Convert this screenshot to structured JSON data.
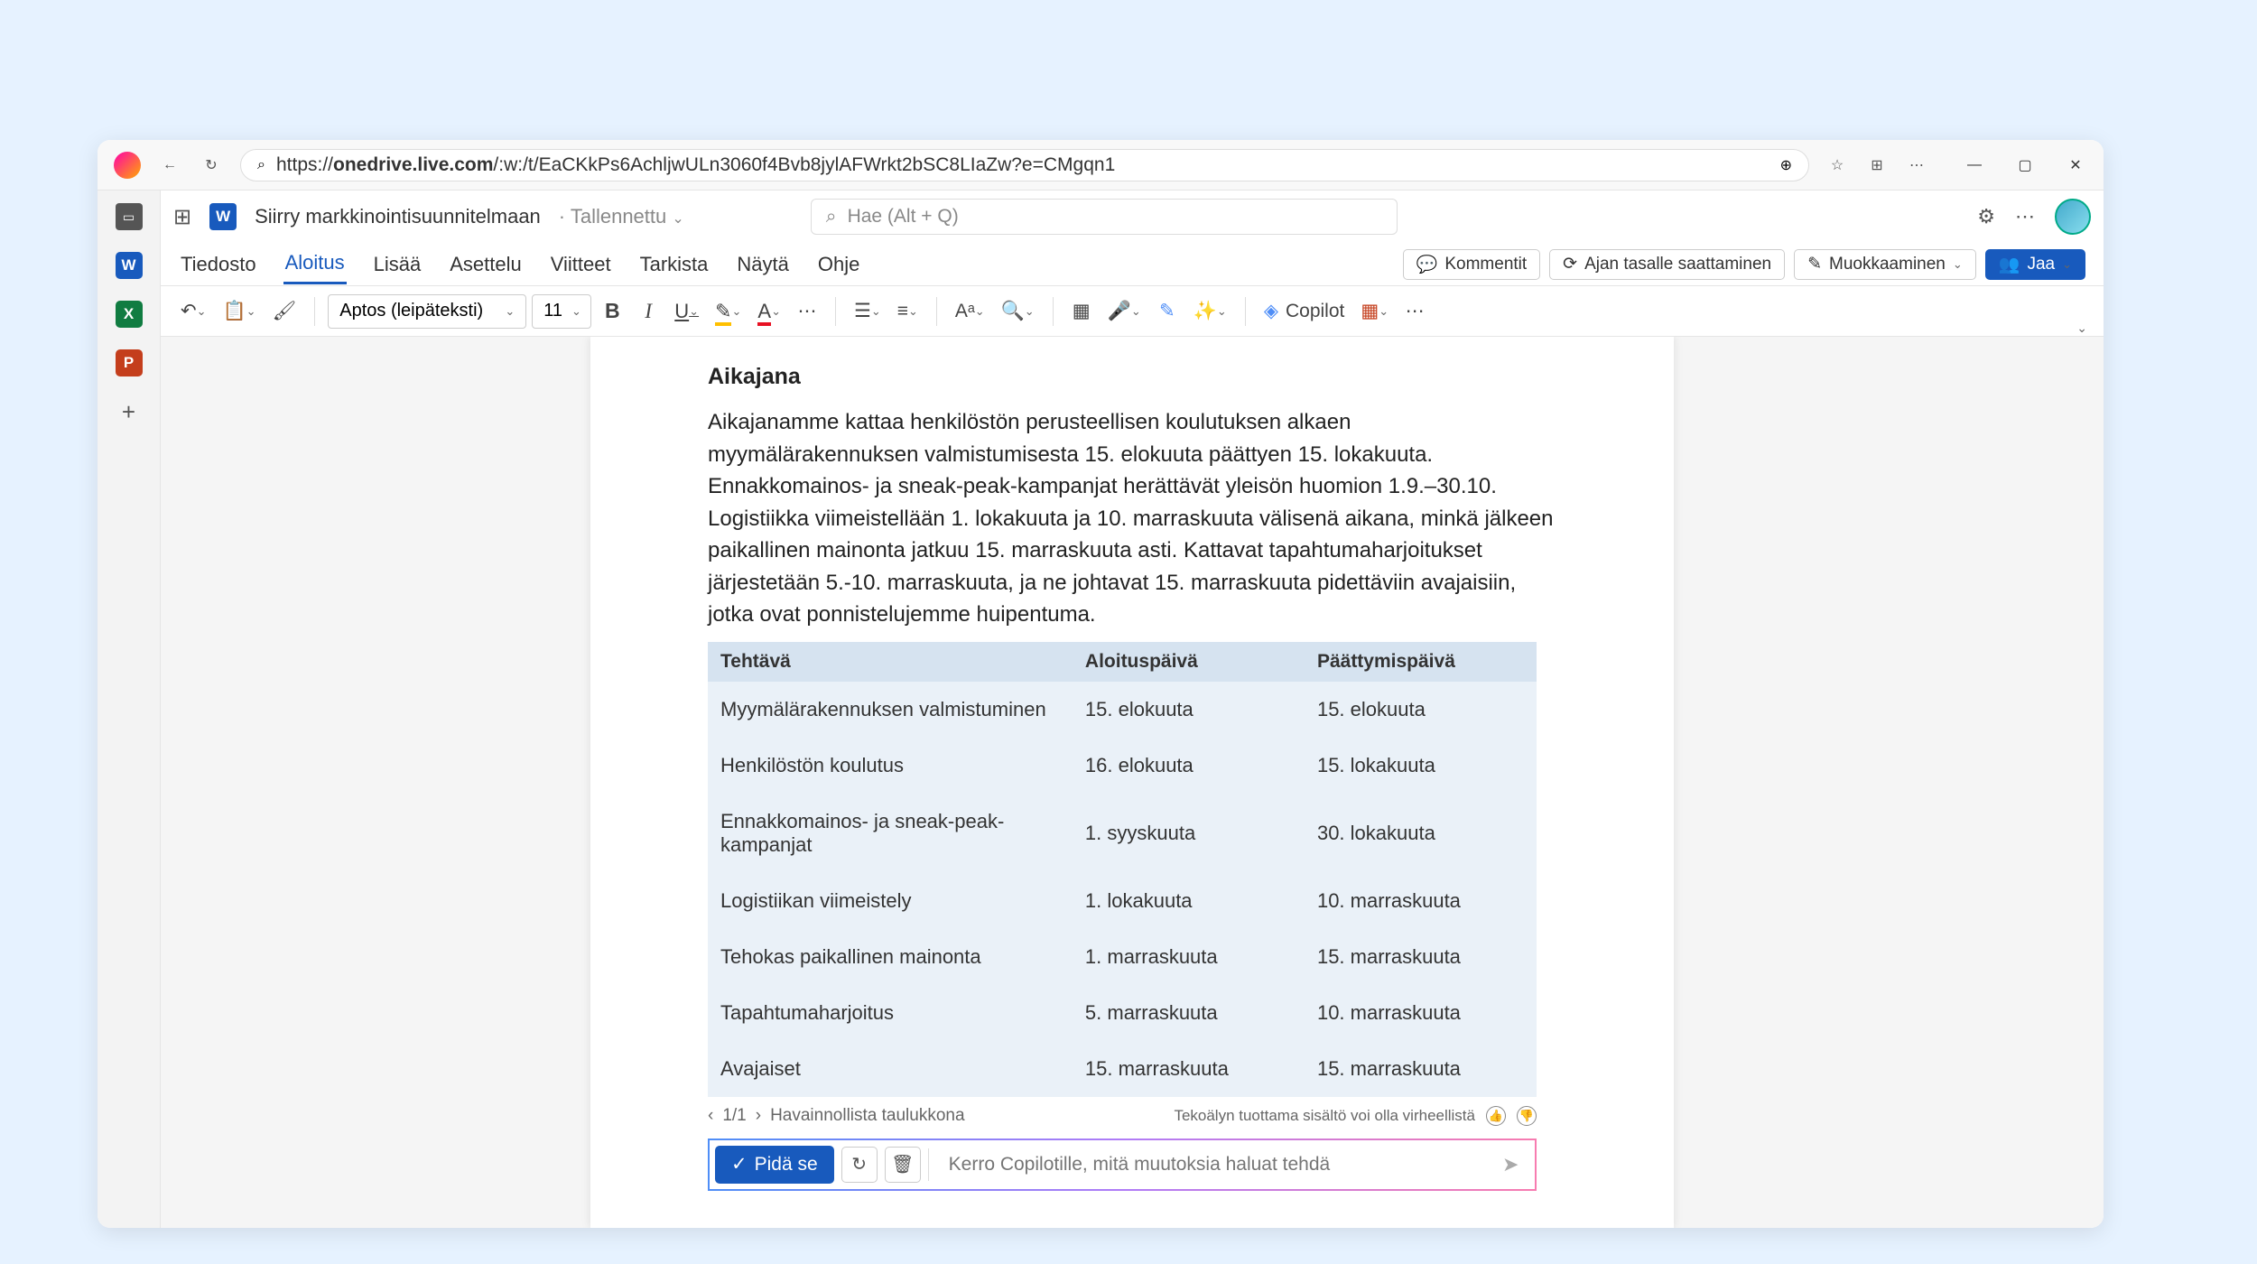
{
  "browser": {
    "url_prefix": "https://",
    "url_domain": "onedrive.live.com",
    "url_path": "/:w:/t/EaCKkPs6AchljwULn3060f4Bvb8jylAFWrkt2bSC8LIaZw?e=CMgqn1"
  },
  "title": {
    "doc_name": "Siirry markkinointisuunnitelmaan",
    "status": "Tallennettu",
    "search_placeholder": "Hae (Alt + Q)"
  },
  "menu": {
    "items": [
      "Tiedosto",
      "Aloitus",
      "Lisää",
      "Asettelu",
      "Viitteet",
      "Tarkista",
      "Näytä",
      "Ohje"
    ],
    "active_index": 1,
    "comments": "Kommentit",
    "catchup": "Ajan tasalle saattaminen",
    "editing": "Muokkaaminen",
    "share": "Jaa"
  },
  "ribbon": {
    "font": "Aptos (leipäteksti)",
    "size": "11",
    "copilot": "Copilot"
  },
  "doc": {
    "heading": "Aikajana",
    "para": "Aikajanamme kattaa henkilöstön perusteellisen koulutuksen alkaen myymälärakennuksen valmistumisesta 15. elokuuta päättyen 15. lokakuuta. Ennakkomainos- ja sneak-peak-kampanjat herättävät yleisön huomion 1.9.–30.10. Logistiikka viimeistellään 1. lokakuuta ja 10. marraskuuta välisenä aikana, minkä jälkeen paikallinen mainonta jatkuu 15. marraskuuta asti. Kattavat tapahtumaharjoitukset järjestetään 5.-10. marraskuuta, ja ne johtavat 15. marraskuuta pidettäviin avajaisiin, jotka ovat ponnistelujemme huipentuma.",
    "headers": [
      "Tehtävä",
      "Aloituspäivä",
      "Päättymispäivä"
    ],
    "rows": [
      {
        "c0": "Myymälärakennuksen valmistuminen",
        "c1": "15. elokuuta",
        "c2": "15. elokuuta"
      },
      {
        "c0": "Henkilöstön koulutus",
        "c1": "16. elokuuta",
        "c2": "15. lokakuuta"
      },
      {
        "c0": "Ennakkomainos- ja sneak-peak-kampanjat",
        "c1": "1. syyskuuta",
        "c2": "30. lokakuuta"
      },
      {
        "c0": "Logistiikan viimeistely",
        "c1": "1. lokakuuta",
        "c2": "10. marraskuuta"
      },
      {
        "c0": "Tehokas paikallinen mainonta",
        "c1": "1. marraskuuta",
        "c2": "15. marraskuuta"
      },
      {
        "c0": "Tapahtumaharjoitus",
        "c1": "5. marraskuuta",
        "c2": "10. marraskuuta"
      },
      {
        "c0": "Avajaiset",
        "c1": "15. marraskuuta",
        "c2": "15. marraskuuta"
      }
    ]
  },
  "footer": {
    "page": "1/1",
    "caption": "Havainnollista taulukkona",
    "ai_notice": "Tekoälyn tuottama sisältö voi olla virheellistä"
  },
  "copilot": {
    "keep": "Pidä se",
    "placeholder": "Kerro Copilotille, mitä muutoksia haluat tehdä"
  }
}
